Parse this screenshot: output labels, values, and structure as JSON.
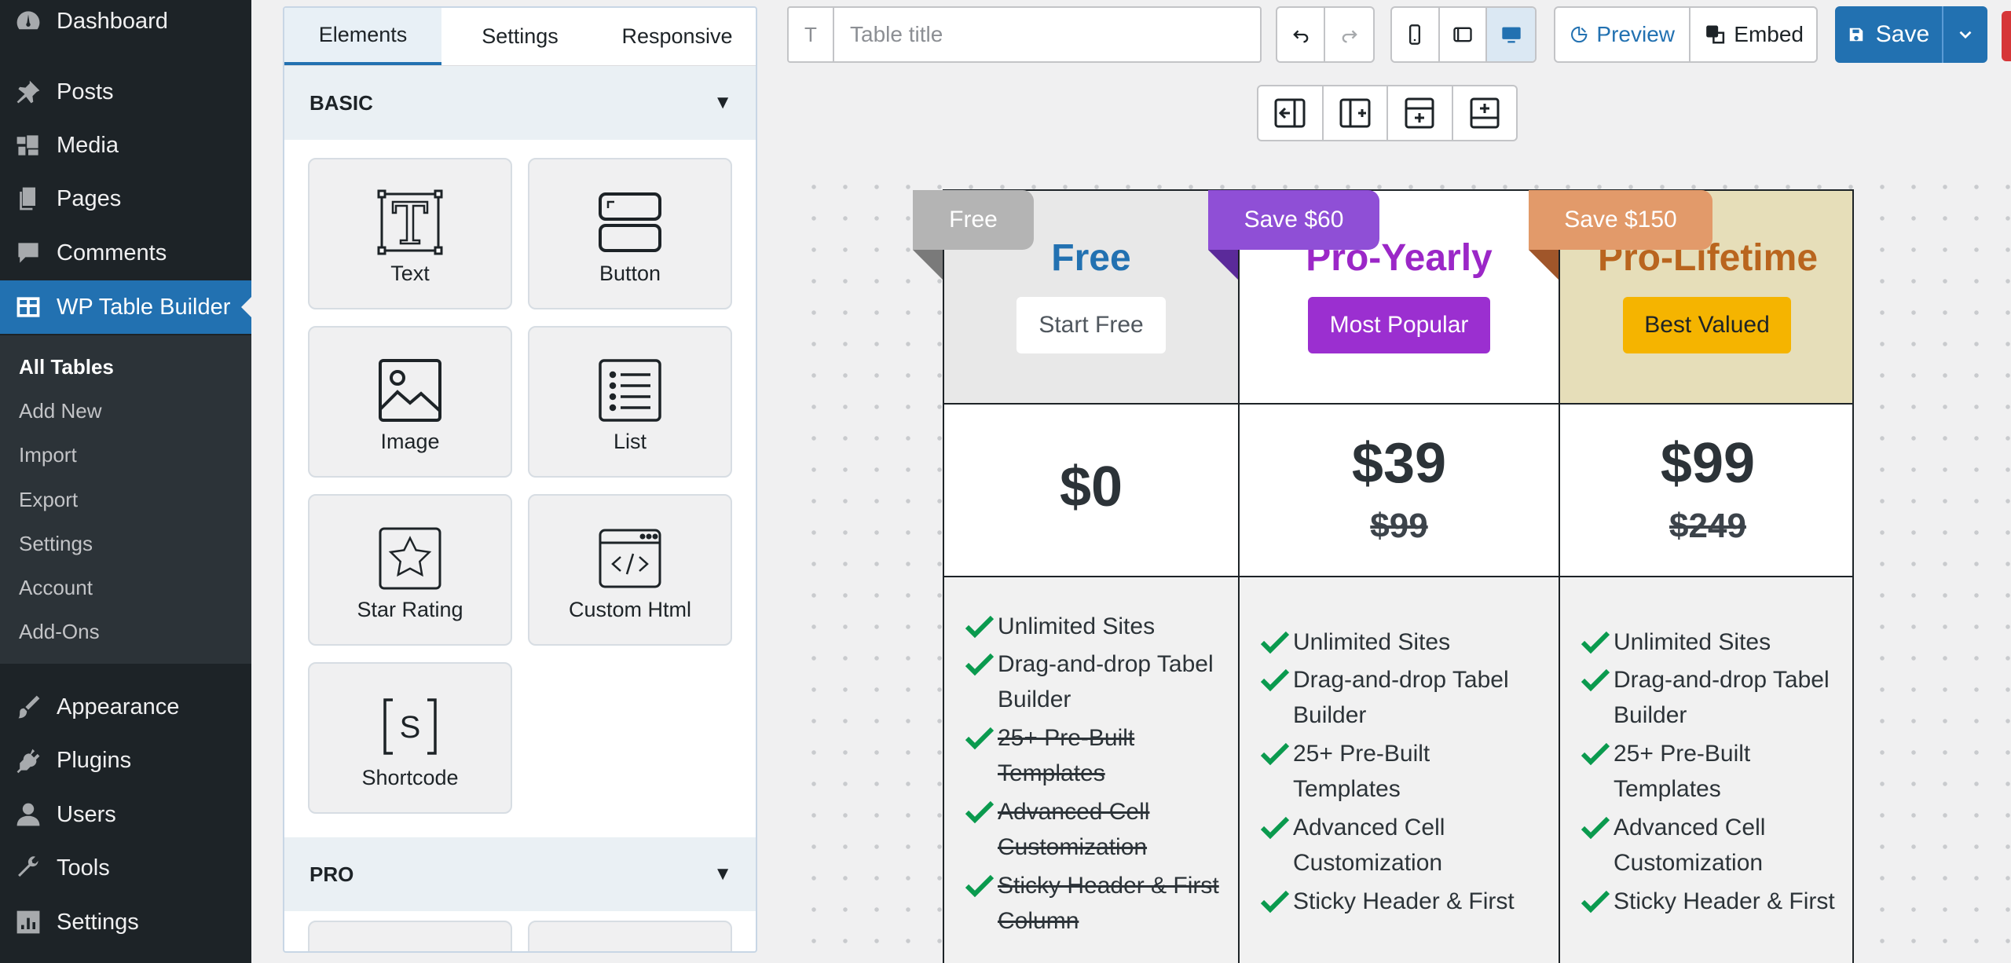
{
  "sidebar": {
    "menu": [
      {
        "label": "Dashboard",
        "icon": "dashboard-icon"
      },
      {
        "label": "Posts",
        "icon": "pin-icon"
      },
      {
        "label": "Media",
        "icon": "media-icon"
      },
      {
        "label": "Pages",
        "icon": "pages-icon"
      },
      {
        "label": "Comments",
        "icon": "comment-icon"
      },
      {
        "label": "WP Table Builder",
        "icon": "table-icon"
      }
    ],
    "submenu": [
      "All Tables",
      "Add New",
      "Import",
      "Export",
      "Settings",
      "Account",
      "Add-Ons"
    ],
    "menu_bottom": [
      {
        "label": "Appearance",
        "icon": "brush-icon"
      },
      {
        "label": "Plugins",
        "icon": "plug-icon"
      },
      {
        "label": "Users",
        "icon": "user-icon"
      },
      {
        "label": "Tools",
        "icon": "wrench-icon"
      },
      {
        "label": "Settings",
        "icon": "settings-icon"
      }
    ]
  },
  "panel": {
    "tabs": [
      "Elements",
      "Settings",
      "Responsive"
    ],
    "basic_heading": "BASIC",
    "pro_heading": "PRO",
    "caret": "▼",
    "elements": [
      {
        "label": "Text",
        "icon": "text-icon"
      },
      {
        "label": "Button",
        "icon": "button-icon"
      },
      {
        "label": "Image",
        "icon": "image-icon"
      },
      {
        "label": "List",
        "icon": "list-icon"
      },
      {
        "label": "Star Rating",
        "icon": "star-rating-icon"
      },
      {
        "label": "Custom Html",
        "icon": "code-icon"
      },
      {
        "label": "Shortcode",
        "icon": "shortcode-icon"
      }
    ]
  },
  "toolbar": {
    "title_icon": "T",
    "title_placeholder": "Table title",
    "preview_label": "Preview",
    "embed_label": "Embed",
    "save_label": "Save",
    "active_device": "desktop"
  },
  "pricing": {
    "plans": [
      {
        "ribbon": "Free",
        "name": "Free",
        "button": "Start Free",
        "price": "$0",
        "old_price": "",
        "colors": {
          "name": "#2271b1",
          "button_bg": "#ffffff",
          "button_text": "#50575e",
          "head_bg": "#e8e8e8",
          "ribbon_bg": "#b4b4b4",
          "ribbon_tail": "#7a7a7a"
        },
        "features": [
          {
            "text": "Unlimited Sites",
            "struck": false
          },
          {
            "text": "Drag-and-drop Tabel Builder",
            "struck": false
          },
          {
            "text": "25+ Pre-Built Templates",
            "struck": true
          },
          {
            "text": "Advanced Cell Customization",
            "struck": true
          },
          {
            "text": "Sticky Header & First Column",
            "struck": true
          }
        ]
      },
      {
        "ribbon": "Save $60",
        "name": "Pro-Yearly",
        "button": "Most Popular",
        "price": "$39",
        "old_price": "$99",
        "colors": {
          "name": "#9b27c7",
          "button_bg": "#9b2fd0",
          "button_text": "#ffffff",
          "head_bg": "#ffffff",
          "ribbon_bg": "#8f4fd6",
          "ribbon_tail": "#5b2a9a"
        },
        "features": [
          {
            "text": "Unlimited Sites",
            "struck": false
          },
          {
            "text": "Drag-and-drop Tabel Builder",
            "struck": false
          },
          {
            "text": "25+ Pre-Built Templates",
            "struck": false
          },
          {
            "text": "Advanced Cell Customization",
            "struck": false
          },
          {
            "text": "Sticky Header & First",
            "struck": false
          }
        ]
      },
      {
        "ribbon": "Save $150",
        "name": "Pro-Lifetime",
        "button": "Best Valued",
        "price": "$99",
        "old_price": "$249",
        "colors": {
          "name": "#b9651e",
          "button_bg": "#f5b400",
          "button_text": "#1d2327",
          "head_bg": "#e6deb9",
          "ribbon_bg": "#e29a6a",
          "ribbon_tail": "#a0562a"
        },
        "features": [
          {
            "text": "Unlimited Sites",
            "struck": false
          },
          {
            "text": "Drag-and-drop Tabel Builder",
            "struck": false
          },
          {
            "text": "25+ Pre-Built Templates",
            "struck": false
          },
          {
            "text": "Advanced Cell Customization",
            "struck": false
          },
          {
            "text": "Sticky Header & First",
            "struck": false
          }
        ]
      }
    ],
    "check_color": "#0a9a4e"
  },
  "colors": {
    "accent": "#2271b1",
    "sidebar_bg": "#1d2327",
    "submenu_bg": "#2c3338"
  }
}
